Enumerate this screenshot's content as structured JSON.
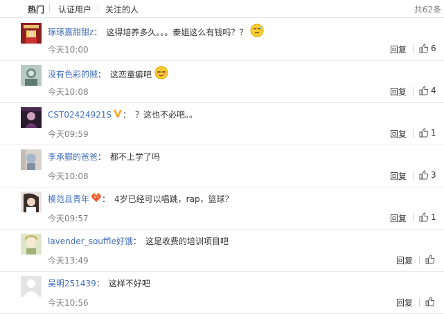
{
  "tabs": {
    "hot": "热门",
    "verified": "认证用户",
    "following": "关注的人",
    "total": "共62条"
  },
  "comments": [
    {
      "user": "琢琢嘉甜甜z",
      "sep": "：",
      "text": "这得培养多久。。。秦姐这么有钱吗？？",
      "time": "今天10:00",
      "reply": "回复",
      "likes": "6"
    },
    {
      "user": "没有色彩的贼",
      "sep": "：",
      "text": "这恋童癖吧",
      "time": "今天10:08",
      "reply": "回复",
      "likes": "4"
    },
    {
      "user": "CST02424921S",
      "sep": "：",
      "text": "？这也不必吧。。",
      "time": "今天09:59",
      "reply": "回复",
      "likes": "1"
    },
    {
      "user": "李承鄞的爸爸",
      "sep": "：",
      "text": "都不上学了吗",
      "time": "今天10:08",
      "reply": "回复",
      "likes": "3"
    },
    {
      "user": "模范且青年",
      "sep": "：",
      "text": "4岁已经可以唱跳，rap，篮球？",
      "time": "今天09:57",
      "reply": "回复",
      "likes": "1"
    },
    {
      "user": "lavender_souffle好饿",
      "sep": "：",
      "text": "这是收费的培训项目吧",
      "time": "今天13:49",
      "reply": "回复",
      "likes": ""
    },
    {
      "user": "吴明251439",
      "sep": "：",
      "text": "这样不好吧",
      "time": "今天10:56",
      "reply": "回复",
      "likes": ""
    }
  ],
  "icons": {
    "like": "thumbs-up-icon",
    "verified": "gold-v-badge-icon",
    "vip": "heart-crown-badge-icon",
    "emoji_sweat": "sweat-face-emoji",
    "emoji_smirk": "smirk-face-emoji"
  },
  "colors": {
    "username": "#3e6dba",
    "time": "#808080",
    "badge_gold": "#f5a623",
    "divider": "#eaeaea"
  }
}
